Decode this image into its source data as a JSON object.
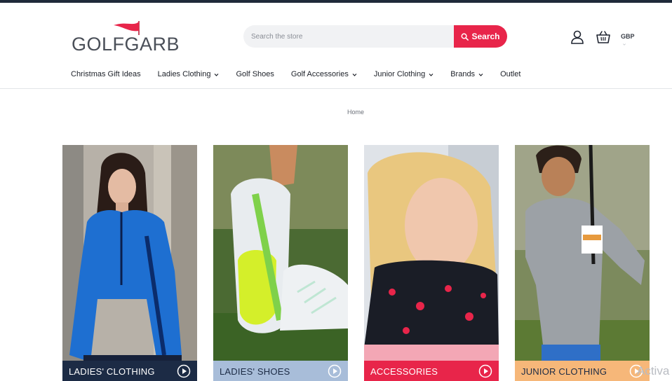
{
  "brand": {
    "name_part1": "GOLF",
    "name_part2": "GARB",
    "flag_color": "#e8254a",
    "text_color": "#4a4f58"
  },
  "search": {
    "placeholder": "Search the store",
    "button_label": "Search",
    "button_color": "#e8254a"
  },
  "header": {
    "account_icon": "user-icon",
    "basket_icon": "basket-icon",
    "currency": "GBP"
  },
  "nav": {
    "items": [
      {
        "label": "Christmas Gift Ideas",
        "has_dropdown": false
      },
      {
        "label": "Ladies Clothing",
        "has_dropdown": true
      },
      {
        "label": "Golf Shoes",
        "has_dropdown": false
      },
      {
        "label": "Golf Accessories",
        "has_dropdown": true
      },
      {
        "label": "Junior Clothing",
        "has_dropdown": true
      },
      {
        "label": "Brands",
        "has_dropdown": true
      },
      {
        "label": "Outlet",
        "has_dropdown": false
      }
    ]
  },
  "breadcrumb": {
    "home": "Home"
  },
  "tiles": [
    {
      "label": "LADIES' CLOTHING",
      "label_color": "#1c2b45"
    },
    {
      "label": "LADIES' SHOES",
      "label_color": "#a8bdd9"
    },
    {
      "label": "ACCESSORIES",
      "label_color": "#e8254a"
    },
    {
      "label": "JUNIOR CLOTHING",
      "label_color": "#f6b779"
    }
  ],
  "overlay": {
    "watermark": "Activa"
  }
}
